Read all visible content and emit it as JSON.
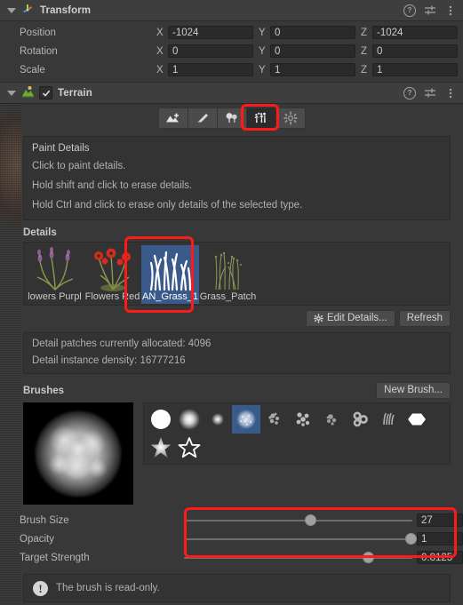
{
  "transform": {
    "title": "Transform",
    "rows": [
      {
        "label": "Position",
        "x": "-1024",
        "y": "0",
        "z": "-1024"
      },
      {
        "label": "Rotation",
        "x": "0",
        "y": "0",
        "z": "0"
      },
      {
        "label": "Scale",
        "x": "1",
        "y": "1",
        "z": "1"
      }
    ],
    "axis_labels": {
      "x": "X",
      "y": "Y",
      "z": "Z"
    }
  },
  "terrain": {
    "title": "Terrain",
    "enabled": true,
    "toolbar": [
      {
        "name": "create-neighbor-terrain",
        "selected": false
      },
      {
        "name": "paint-terrain",
        "selected": false
      },
      {
        "name": "paint-trees",
        "selected": false
      },
      {
        "name": "paint-details",
        "selected": true
      },
      {
        "name": "terrain-settings",
        "selected": false
      }
    ],
    "help": {
      "title": "Paint Details",
      "lines": [
        "Click to paint details.",
        "Hold shift and click to erase details.",
        "Hold Ctrl and click to erase only details of the selected type."
      ]
    },
    "details_label": "Details",
    "details": [
      {
        "name": "lowers Purpl",
        "selected": false,
        "kind": "flowers-purple"
      },
      {
        "name": "Flowers Red",
        "selected": false,
        "kind": "flowers-red"
      },
      {
        "name": "AN_Grass_1",
        "selected": true,
        "kind": "grass-white"
      },
      {
        "name": "Grass_Patch",
        "selected": false,
        "kind": "grass-patch"
      }
    ],
    "edit_details_label": "Edit Details...",
    "refresh_label": "Refresh",
    "stats": [
      "Detail patches currently allocated: 4096",
      "Detail instance density: 16777216"
    ],
    "brushes_label": "Brushes",
    "new_brush_label": "New Brush...",
    "brushes": [
      {
        "kind": "solid-circle",
        "selected": false
      },
      {
        "kind": "soft-circle",
        "selected": false
      },
      {
        "kind": "tiny-soft-circle",
        "selected": false
      },
      {
        "kind": "noise-circle",
        "selected": true
      },
      {
        "kind": "speckle-a",
        "selected": false
      },
      {
        "kind": "speckle-b",
        "selected": false
      },
      {
        "kind": "speckle-c",
        "selected": false
      },
      {
        "kind": "blobs",
        "selected": false
      },
      {
        "kind": "streaks",
        "selected": false
      },
      {
        "kind": "hexagon",
        "selected": false
      },
      {
        "kind": "star-soft",
        "selected": false
      },
      {
        "kind": "star-outline",
        "selected": false
      }
    ],
    "sliders": [
      {
        "label": "Brush Size",
        "value": "27",
        "percent": 55
      },
      {
        "label": "Opacity",
        "value": "1",
        "percent": 99
      },
      {
        "label": "Target Strength",
        "value": "0.8125",
        "percent": 80
      }
    ],
    "warning": "The brush is read-only."
  },
  "icons": {
    "help": "?",
    "preset": "preset-icon",
    "menu": "kebab-menu-icon"
  },
  "colors": {
    "accent_selected": "#3b5a8c",
    "highlight_box": "#ff1a1a",
    "panel_bg": "#383838",
    "header_bg": "#3e3e3e"
  }
}
